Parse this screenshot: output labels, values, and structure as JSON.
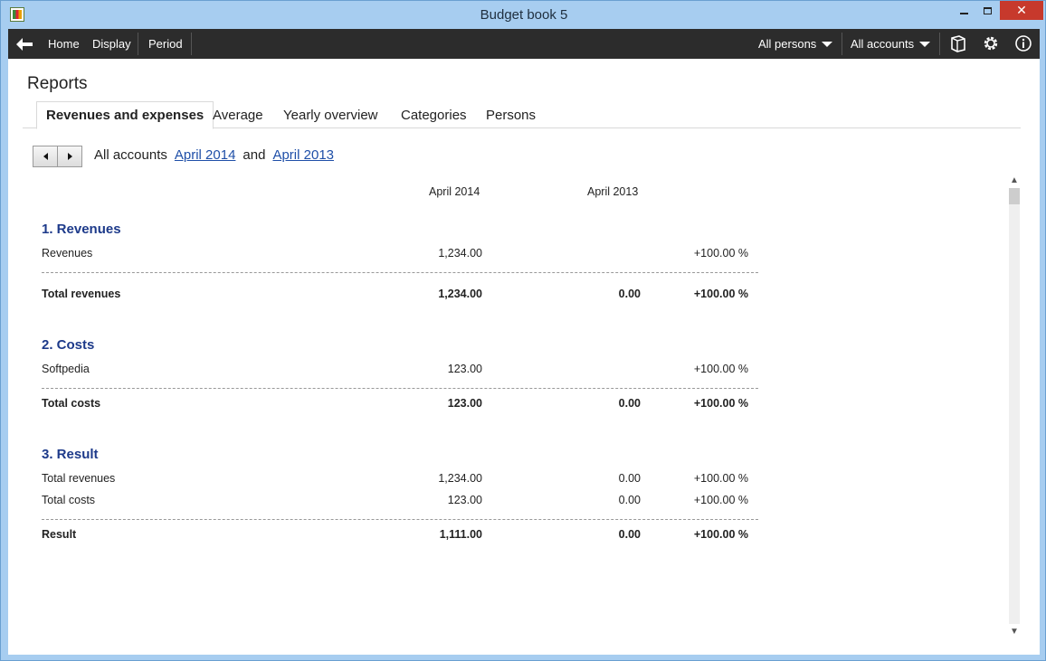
{
  "window": {
    "title": "Budget book 5"
  },
  "toolbar": {
    "home": "Home",
    "display": "Display",
    "period": "Period",
    "persons": "All persons",
    "accounts": "All accounts",
    "icons": [
      "back-arrow-icon",
      "book-icon",
      "gear-icon",
      "info-icon"
    ]
  },
  "page": {
    "title": "Reports"
  },
  "tabs": [
    {
      "label": "Revenues and expenses",
      "active": true
    },
    {
      "label": "Average",
      "active": false
    },
    {
      "label": "Yearly overview",
      "active": false
    },
    {
      "label": "Categories",
      "active": false
    },
    {
      "label": "Persons",
      "active": false
    }
  ],
  "filter": {
    "prefix": "All accounts",
    "period1": "April 2014",
    "joiner": "and",
    "period2": "April 2013"
  },
  "report": {
    "col1": "April 2014",
    "col2": "April 2013",
    "revenues": {
      "title": "1. Revenues",
      "rows": [
        {
          "label": "Revenues",
          "v1": "1,234.00",
          "v2": "",
          "v3": "+100.00 %"
        }
      ],
      "total": {
        "label": "Total revenues",
        "v1": "1,234.00",
        "v2": "0.00",
        "v3": "+100.00 %"
      }
    },
    "costs": {
      "title": "2. Costs",
      "rows": [
        {
          "label": "Softpedia",
          "v1": "123.00",
          "v2": "",
          "v3": "+100.00 %"
        }
      ],
      "total": {
        "label": "Total costs",
        "v1": "123.00",
        "v2": "0.00",
        "v3": "+100.00 %"
      }
    },
    "result": {
      "title": "3. Result",
      "rows": [
        {
          "label": "Total revenues",
          "v1": "1,234.00",
          "v2": "0.00",
          "v3": "+100.00 %"
        },
        {
          "label": "Total costs",
          "v1": "123.00",
          "v2": "0.00",
          "v3": "+100.00 %"
        }
      ],
      "total": {
        "label": "Result",
        "v1": "1,111.00",
        "v2": "0.00",
        "v3": "+100.00 %"
      }
    }
  }
}
